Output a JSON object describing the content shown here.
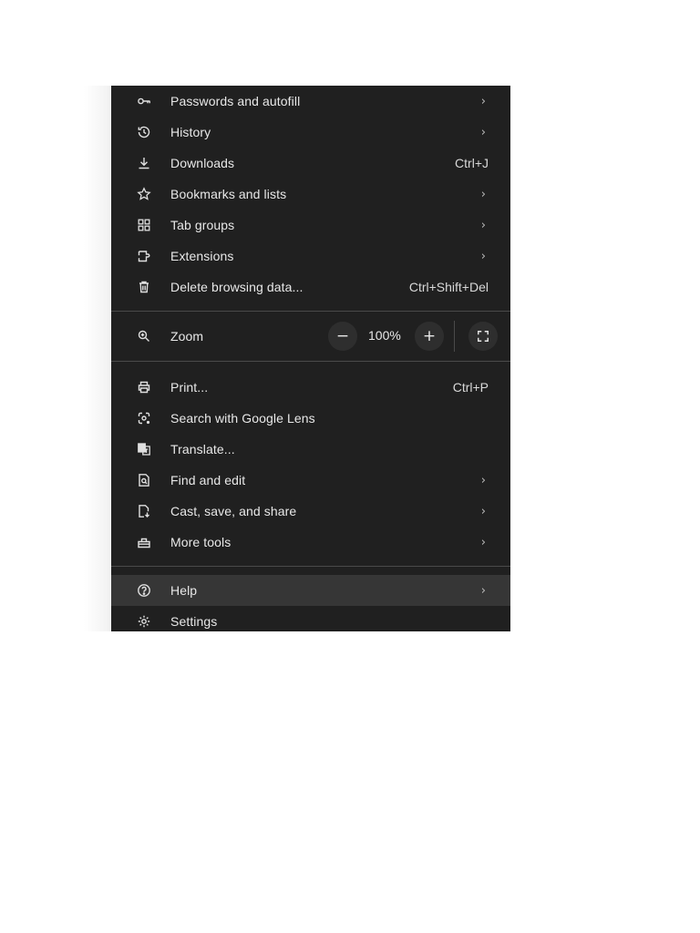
{
  "menu": {
    "group1": [
      {
        "label": "Passwords and autofill",
        "icon": "key-icon",
        "submenu": true
      },
      {
        "label": "History",
        "icon": "history-icon",
        "submenu": true
      },
      {
        "label": "Downloads",
        "icon": "download-icon",
        "shortcut": "Ctrl+J"
      },
      {
        "label": "Bookmarks and lists",
        "icon": "star-icon",
        "submenu": true
      },
      {
        "label": "Tab groups",
        "icon": "tab-groups-icon",
        "submenu": true
      },
      {
        "label": "Extensions",
        "icon": "puzzle-icon",
        "submenu": true
      },
      {
        "label": "Delete browsing data...",
        "icon": "trash-icon",
        "shortcut": "Ctrl+Shift+Del"
      }
    ],
    "zoom": {
      "label": "Zoom",
      "icon": "zoom-icon",
      "value": "100%",
      "minus": "−",
      "plus": "+",
      "fullscreen_icon": "fullscreen-icon"
    },
    "group2": [
      {
        "label": "Print...",
        "icon": "printer-icon",
        "shortcut": "Ctrl+P"
      },
      {
        "label": "Search with Google Lens",
        "icon": "lens-icon"
      },
      {
        "label": "Translate...",
        "icon": "translate-icon"
      },
      {
        "label": "Find and edit",
        "icon": "find-icon",
        "submenu": true
      },
      {
        "label": "Cast, save, and share",
        "icon": "cast-save-icon",
        "submenu": true
      },
      {
        "label": "More tools",
        "icon": "toolbox-icon",
        "submenu": true
      }
    ],
    "group3": [
      {
        "label": "Help",
        "icon": "help-icon",
        "submenu": true,
        "highlighted": true
      },
      {
        "label": "Settings",
        "icon": "settings-icon"
      }
    ],
    "chevron": "›",
    "colors": {
      "background": "#202020",
      "highlight": "#363636",
      "text": "#e8e8e8",
      "separator": "#4a4a4a"
    }
  }
}
